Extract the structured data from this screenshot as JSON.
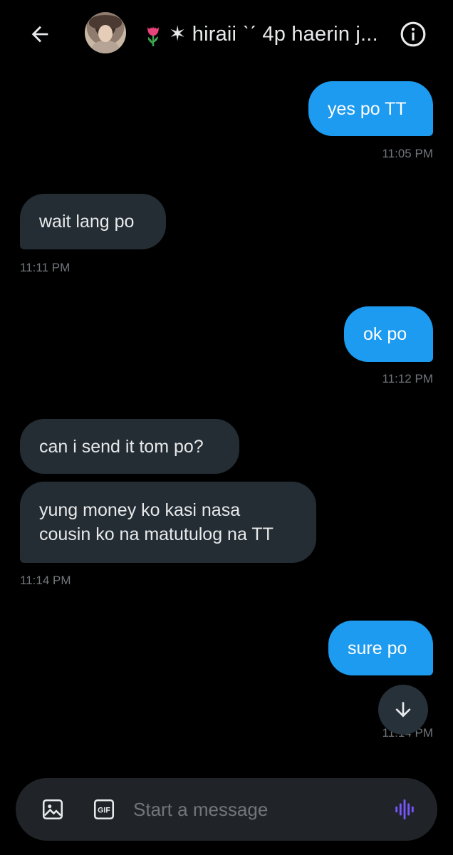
{
  "header": {
    "title": "✶ hiraii ˋˊ 4p haerin j...",
    "back_icon": "arrow-left-icon",
    "info_icon": "info-icon",
    "title_emoji": "tulip-icon"
  },
  "messages": [
    {
      "side": "sent",
      "text": "yes po TT",
      "time": "11:05 PM"
    },
    {
      "side": "received",
      "text": "wait lang po",
      "time": "11:11 PM"
    },
    {
      "side": "sent",
      "text": "ok po",
      "time": "11:12 PM"
    },
    {
      "side": "received",
      "text": "can i send it tom po?",
      "time": ""
    },
    {
      "side": "received",
      "text_lines": [
        "yung money ko kasi nasa",
        "cousin ko na matutulog na TT"
      ],
      "time": "11:14 PM"
    },
    {
      "side": "sent",
      "text": "sure po",
      "time": "11:14 PM"
    }
  ],
  "composer": {
    "placeholder": "Start a message",
    "icons": [
      "image-icon",
      "gif-icon",
      "voice-icon"
    ]
  },
  "colors": {
    "background": "#000000",
    "sent_bubble": "#1d9bf0",
    "received_bubble": "#242d34",
    "timestamp": "#71767b",
    "voice_accent": "#7856ff"
  }
}
